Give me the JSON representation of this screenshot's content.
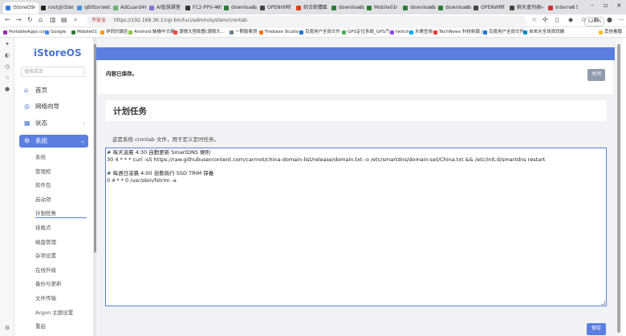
{
  "browser": {
    "tabs": [
      {
        "label": "iStoreOS",
        "color": "#3b78e7",
        "active": true
      },
      {
        "label": "root@iStor",
        "color": "#222222"
      },
      {
        "label": "qBittorrent",
        "color": "#4a90d9"
      },
      {
        "label": "AdGuard H",
        "color": "#66b574"
      },
      {
        "label": "AI智慧課堂",
        "color": "#8e6cd1"
      },
      {
        "label": "FC2-PPV-4959",
        "color": "#333333"
      },
      {
        "label": "downloads",
        "color": "#2e7d32"
      },
      {
        "label": "OPENWRT",
        "color": "#444444"
      },
      {
        "label": "綜合軟體區",
        "color": "#d84315"
      },
      {
        "label": "downloads",
        "color": "#2e7d32"
      },
      {
        "label": "Mobile01",
        "color": "#2e7d32"
      },
      {
        "label": "downloads",
        "color": "#2e7d32"
      },
      {
        "label": "downloads",
        "color": "#2e7d32"
      },
      {
        "label": "OPENWRT",
        "color": "#444444"
      },
      {
        "label": "聊天會列表 - L",
        "color": "#444444"
      },
      {
        "label": "Internet S",
        "color": "#d32f2f"
      }
    ],
    "security_label": "不安全",
    "url": "https://192.168.36.1/cgi-bin/luci/admin/system/crontab",
    "zoom": "120%",
    "bookmarks": [
      {
        "label": "PortableApps.com",
        "color": "#9c27b0"
      },
      {
        "label": "Google",
        "color": "#4285f4"
      },
      {
        "label": "Mobile01",
        "color": "#2e7d32"
      },
      {
        "label": "伊莉討論區",
        "color": "#ff9800"
      },
      {
        "label": "Android 裝機中文網",
        "color": "#8bc34a"
      },
      {
        "label": "潮價大陸軟體(潮價大...",
        "color": "#f44336"
      },
      {
        "label": "一期製案資",
        "color": "#607d8b"
      },
      {
        "label": "Firebase Studio",
        "color": "#ff6f00"
      },
      {
        "label": "百度用户全部文件",
        "color": "#1976d2"
      },
      {
        "label": "GPS定位系統_GPS汽...",
        "color": "#4caf50"
      },
      {
        "label": "twitch",
        "color": "#9146ff"
      },
      {
        "label": "水費查詢",
        "color": "#03a9f4"
      },
      {
        "label": "TechNews 科技新報 |...",
        "color": "#e53935"
      },
      {
        "label": "百度用户全部文件",
        "color": "#1976d2"
      },
      {
        "label": "自來水全球資訊網",
        "color": "#0288d1"
      },
      {
        "label": "其他書籤",
        "color": "#fbc02d"
      }
    ]
  },
  "sidebar": {
    "logo": "iStoreOS",
    "search_placeholder": "搜索菜单",
    "menu": [
      {
        "label": "首页",
        "icon": "home-icon",
        "glyph": "⌂"
      },
      {
        "label": "网络向导",
        "icon": "wizard-icon",
        "glyph": "◎"
      },
      {
        "label": "状态",
        "icon": "status-icon",
        "glyph": "▦",
        "chevron": "›"
      },
      {
        "label": "系统",
        "icon": "gear-icon",
        "glyph": "⚙",
        "chevron": "⌄"
      }
    ],
    "submenu": [
      "系统",
      "管理权",
      "软件包",
      "启动项",
      "计划任务",
      "挂载点",
      "磁盘管理",
      "杂项设置",
      "在线升级",
      "备份与更新",
      "文件传输",
      "Argon 主题设置",
      "重启"
    ]
  },
  "main": {
    "alert_text": "内容已保存。",
    "close_label": "关闭",
    "title": "计划任务",
    "description": "这是系统 crontab 文件，用于定义定时任务。",
    "crontab_lines": [
      "# 每天凌晨 4:30 自動更新 SmartDNS 規則",
      "30 4 * * * curl -sS https://raw.githubusercontent.com/carrnot/china-domain-list/release/domain.txt -o /etc/smartdns/domain-set/China.txt && /etc/init.d/smartdns restart",
      "",
      "# 每週日凌晨 4:00 自動執行 SSD TRIM 保養",
      "0 4 * * 0 /usr/sbin/fstrim -a"
    ],
    "save_label": "保存"
  }
}
